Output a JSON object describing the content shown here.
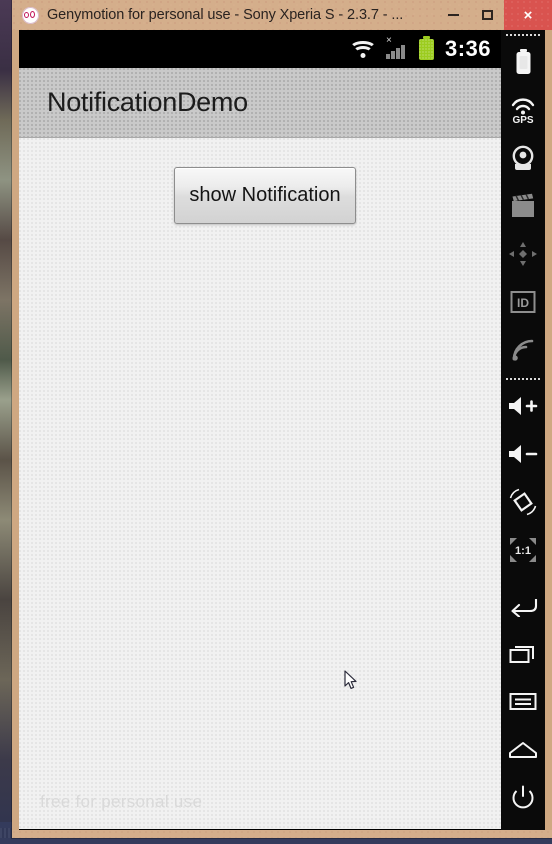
{
  "window": {
    "title": "Genymotion for personal use - Sony Xperia S - 2.3.7 - ...",
    "app_icon": "genymotion-logo-icon",
    "controls": {
      "minimize_label": "–",
      "maximize_label": "□",
      "close_label": "×"
    },
    "colors": {
      "titlebar_bg": "#d4ae8b",
      "close_bg": "#d9534f",
      "frame": "#cfa882"
    }
  },
  "android": {
    "statusbar": {
      "wifi_icon": "wifi-icon",
      "signal_icon": "signal-no-sim-icon",
      "signal_badge": "×",
      "battery_icon": "battery-full-icon",
      "battery_color": "#9ccc1f",
      "time": "3:36"
    },
    "actionbar": {
      "title": "NotificationDemo",
      "bg_color": "#c9c9c9"
    },
    "content": {
      "button_label": "show Notification",
      "watermark": "free for personal use",
      "bg_color": "#f1f1f1"
    }
  },
  "toolbar": {
    "items": [
      {
        "name": "battery-widget-icon",
        "label": "Battery"
      },
      {
        "name": "gps-widget-icon",
        "label": "GPS"
      },
      {
        "name": "camera-widget-icon",
        "label": "Camera"
      },
      {
        "name": "video-capture-icon",
        "label": "Screencast"
      },
      {
        "name": "pan-move-icon",
        "label": "Move"
      },
      {
        "name": "identifiers-icon",
        "label": "ID"
      },
      {
        "name": "network-signal-icon",
        "label": "Network"
      },
      {
        "name": "volume-up-icon",
        "label": "Volume up"
      },
      {
        "name": "volume-down-icon",
        "label": "Volume down"
      },
      {
        "name": "rotate-screen-icon",
        "label": "Rotate"
      },
      {
        "name": "scale-one-to-one-icon",
        "label": "1:1"
      },
      {
        "name": "back-navigation-icon",
        "label": "Back"
      },
      {
        "name": "recent-apps-icon",
        "label": "Recent apps"
      },
      {
        "name": "menu-icon",
        "label": "Menu"
      },
      {
        "name": "home-icon",
        "label": "Home"
      },
      {
        "name": "power-icon",
        "label": "Power"
      }
    ],
    "gps_text": "GPS",
    "id_text": "ID",
    "scale_text": "1:1"
  }
}
